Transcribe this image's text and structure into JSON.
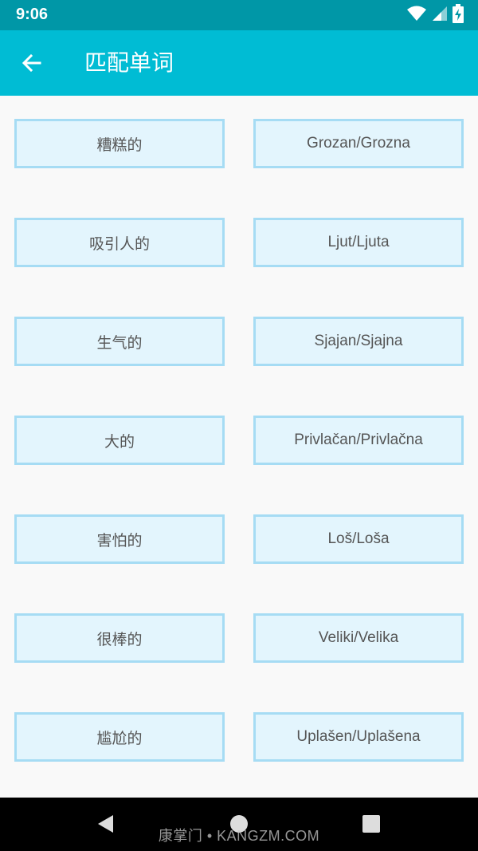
{
  "status_bar": {
    "time": "9:06",
    "icons": [
      "wifi-icon",
      "signal-icon",
      "battery-charging-icon"
    ]
  },
  "app_bar": {
    "back_icon": "arrow-left-icon",
    "title": "匹配单词"
  },
  "left_words": [
    "糟糕的",
    "吸引人的",
    "生气的",
    "大的",
    "害怕的",
    "很棒的",
    "尴尬的"
  ],
  "right_words": [
    "Grozan/Grozna",
    "Ljut/Ljuta",
    "Sjajan/Sjajna",
    "Privlačan/Privlačna",
    "Loš/Loša",
    "Veliki/Velika",
    "Uplašen/Uplašena"
  ],
  "nav_bar": {
    "icons": [
      "back-triangle-icon",
      "home-circle-icon",
      "recents-square-icon"
    ]
  },
  "watermark": "康掌门 • KANGZM.COM",
  "colors": {
    "status_bar": "#0097a7",
    "app_bar": "#00bcd4",
    "card_fill": "#e3f5fd",
    "card_border": "#a6dcf4",
    "background": "#f9f9f9"
  }
}
